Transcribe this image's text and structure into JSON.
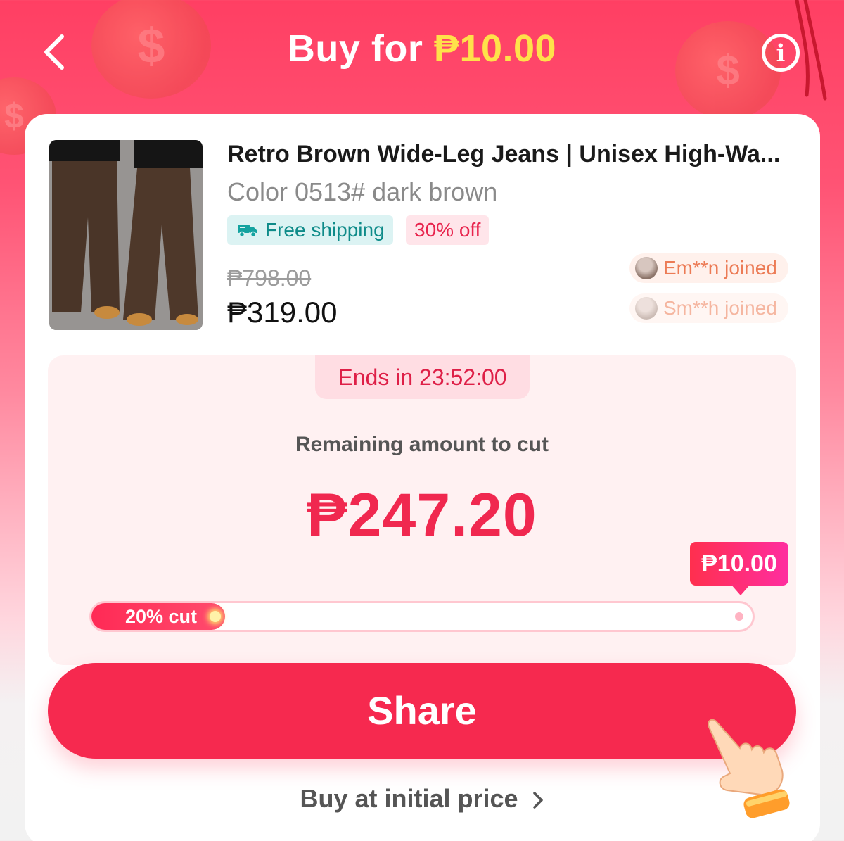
{
  "header": {
    "title_prefix": "Buy for",
    "title_amount": "₱10.00"
  },
  "product": {
    "title": "Retro Brown Wide-Leg Jeans | Unisex High-Wa...",
    "variant": "Color 0513# dark brown",
    "tags": {
      "shipping": "Free shipping",
      "discount": "30% off"
    },
    "original_price": "₱798.00",
    "price": "₱319.00"
  },
  "participants": [
    {
      "label": "Em**n joined"
    },
    {
      "label": "Sm**h joined"
    }
  ],
  "cut": {
    "ends_in": "Ends in 23:52:00",
    "remaining_label": "Remaining amount to cut",
    "remaining_amount": "₱247.20",
    "target_label": "₱10.00",
    "progress_label": "20% cut",
    "progress_fraction": 0.2
  },
  "actions": {
    "share_label": "Share",
    "buy_initial_label": "Buy at initial price"
  },
  "colors": {
    "primary": "#f6294f",
    "accent_yellow": "#ffe14a",
    "shipping_tag": "#0e8b89"
  },
  "icons": [
    "back-arrow-icon",
    "info-icon",
    "truck-icon",
    "pointing-hand-icon",
    "chevron-right-icon"
  ]
}
